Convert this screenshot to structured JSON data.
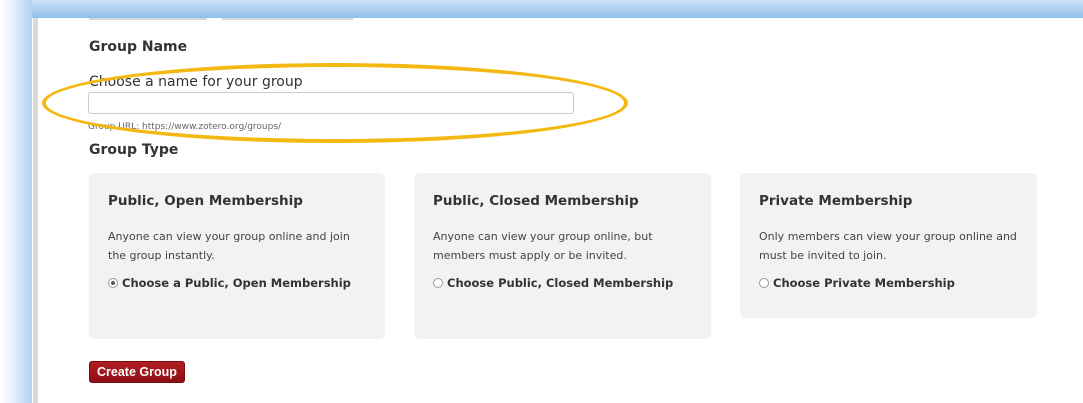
{
  "group_name": {
    "heading": "Group Name",
    "field_label": "Choose a name for your group",
    "input_value": "",
    "input_placeholder": "",
    "url_hint": "Group URL: https://www.zotero.org/groups/"
  },
  "group_type": {
    "heading": "Group Type",
    "options": [
      {
        "title": "Public, Open Membership",
        "description": "Anyone can view your group online and join the group instantly.",
        "choice_label": "Choose a Public, Open Membership",
        "selected": true
      },
      {
        "title": "Public, Closed Membership",
        "description": "Anyone can view your group online, but members must apply or be invited.",
        "choice_label": "Choose Public, Closed Membership",
        "selected": false
      },
      {
        "title": "Private Membership",
        "description": "Only members can view your group online and must be invited to join.",
        "choice_label": "Choose Private Membership",
        "selected": false
      }
    ]
  },
  "actions": {
    "create_label": "Create Group"
  },
  "colors": {
    "highlight": "#f3b812",
    "button": "#9d151a",
    "card_background": "#f2f2f2",
    "frame_glow": "#a9cdf0"
  }
}
